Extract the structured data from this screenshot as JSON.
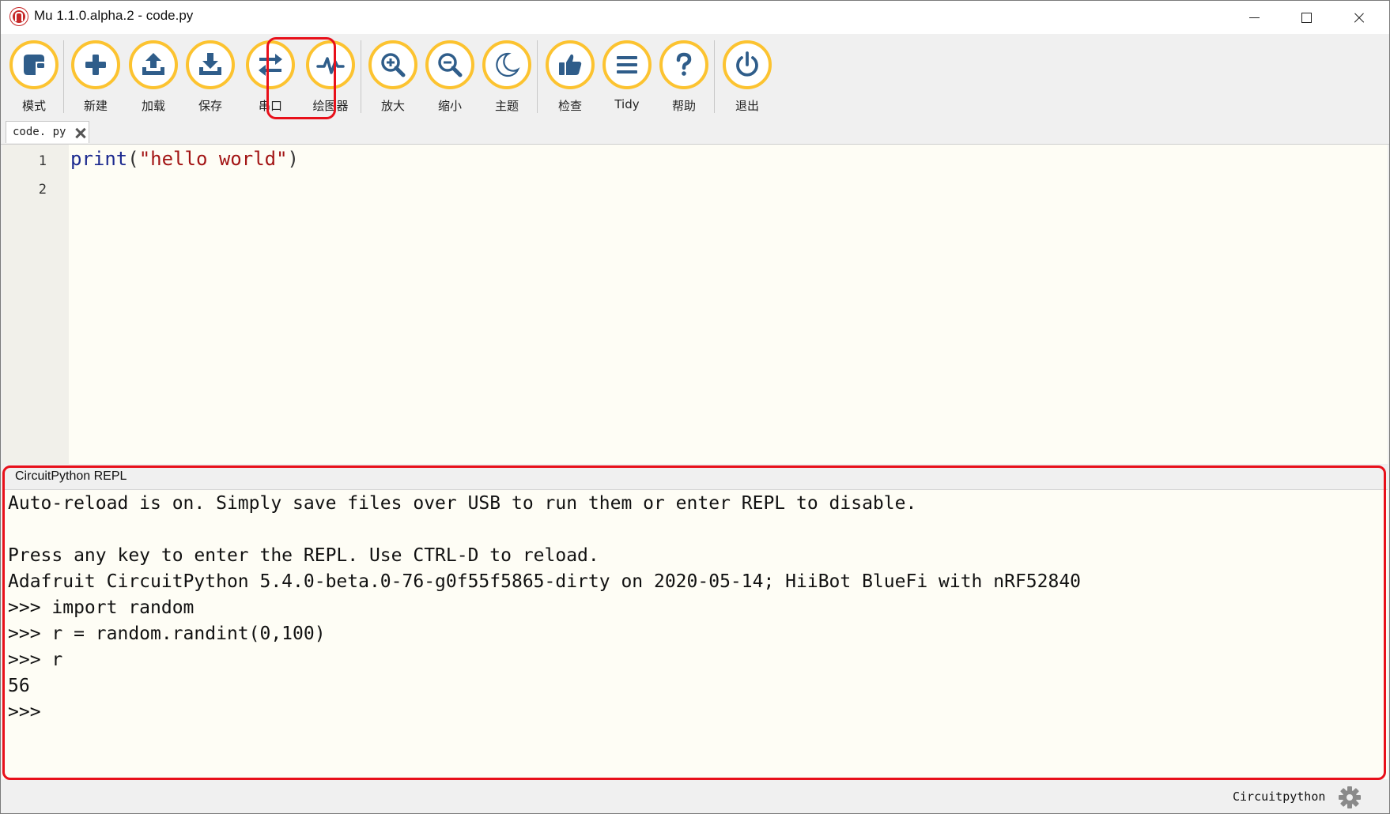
{
  "window": {
    "title": "Mu 1.1.0.alpha.2 - code.py"
  },
  "toolbar": {
    "items": [
      {
        "id": "mode",
        "label": "模式",
        "icon": "mode-icon"
      },
      {
        "id": "new",
        "label": "新建",
        "icon": "plus-icon"
      },
      {
        "id": "load",
        "label": "加载",
        "icon": "upload-icon"
      },
      {
        "id": "save",
        "label": "保存",
        "icon": "download-icon"
      },
      {
        "id": "serial",
        "label": "串口",
        "icon": "swap-arrows-icon"
      },
      {
        "id": "plotter",
        "label": "绘图器",
        "icon": "pulse-icon"
      },
      {
        "id": "zoom-in",
        "label": "放大",
        "icon": "zoom-in-icon"
      },
      {
        "id": "zoom-out",
        "label": "缩小",
        "icon": "zoom-out-icon"
      },
      {
        "id": "theme",
        "label": "主题",
        "icon": "moon-icon"
      },
      {
        "id": "check",
        "label": "检查",
        "icon": "thumbs-up-icon"
      },
      {
        "id": "tidy",
        "label": "Tidy",
        "icon": "lines-icon"
      },
      {
        "id": "help",
        "label": "帮助",
        "icon": "question-icon"
      },
      {
        "id": "quit",
        "label": "退出",
        "icon": "power-icon"
      }
    ],
    "accent": "#fcc330",
    "icon_color": "#2f5d8a"
  },
  "tabs": [
    {
      "label": "code. py"
    }
  ],
  "editor": {
    "line_numbers": [
      "1",
      "2"
    ],
    "code": {
      "keyword": "print",
      "open": "(",
      "string": "\"hello world\"",
      "close": ")"
    }
  },
  "repl": {
    "title": "CircuitPython REPL",
    "lines": [
      "Auto-reload is on. Simply save files over USB to run them or enter REPL to disable.",
      "",
      "Press any key to enter the REPL. Use CTRL-D to reload.",
      "Adafruit CircuitPython 5.4.0-beta.0-76-g0f55f5865-dirty on 2020-05-14; HiiBot BlueFi with nRF52840",
      ">>> import random",
      ">>> r = random.randint(0,100)",
      ">>> r",
      "56",
      ">>>"
    ]
  },
  "status": {
    "mode": "Circuitpython",
    "settings_icon": "gear-icon"
  },
  "highlight_color": "#e8101a"
}
